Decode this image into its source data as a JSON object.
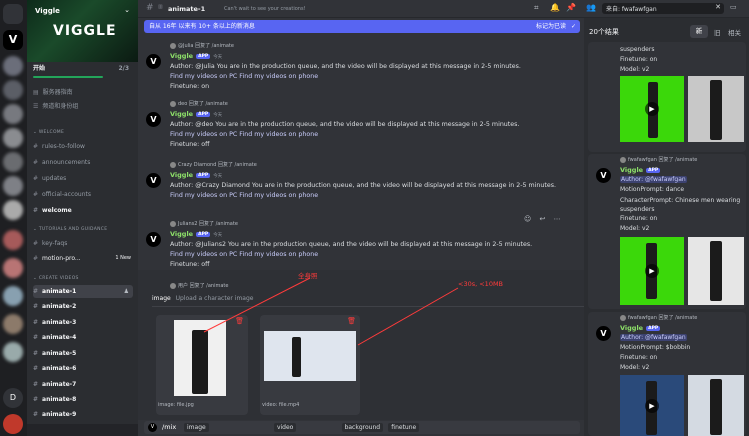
{
  "server": {
    "name": "Viggle",
    "logo": "VIGGLE"
  },
  "channels": {
    "start_label": "开始",
    "start_count": "2/3",
    "items": [
      {
        "label": "服务器指南"
      },
      {
        "label": "频道和身份组"
      }
    ],
    "welcome_category": "WELCOME",
    "welcome_items": [
      {
        "label": "rules-to-follow"
      },
      {
        "label": "announcements"
      },
      {
        "label": "updates"
      },
      {
        "label": "official-accounts"
      },
      {
        "label": "welcome"
      }
    ],
    "tutorials_category": "TUTORIALS AND GUIDANCE",
    "tutorial_items": [
      {
        "label": "key-faqs"
      },
      {
        "label": "motion-pro..."
      }
    ],
    "new_label": "1 New",
    "create_category": "CREATE VIDEOS",
    "create_items": [
      {
        "label": "animate-1"
      },
      {
        "label": "animate-2"
      },
      {
        "label": "animate-3"
      },
      {
        "label": "animate-4"
      },
      {
        "label": "animate-5"
      },
      {
        "label": "animate-6"
      },
      {
        "label": "animate-7"
      },
      {
        "label": "animate-8"
      },
      {
        "label": "animate-9"
      }
    ]
  },
  "topbar": {
    "channel": "animate-1",
    "topic": "Can't wait to see your creations!",
    "search": "来自: fwafawfgan"
  },
  "notice": {
    "text": "自从 16年 以来有 10+ 条以上的新消息",
    "action": "标记为已读"
  },
  "messages": [
    {
      "reply": "@Julia 回复了 /animate",
      "user": "Viggle",
      "app": "APP",
      "time": "今天",
      "body": "Author: @Julia You are in the production queue, and the video will be displayed at this message in 2-5 minutes.",
      "links": "Find my videos on PC   Find my videos on phone",
      "extra": "Finetune: on"
    },
    {
      "reply": "deo 回复了 /animate",
      "user": "Viggle",
      "app": "APP",
      "time": "今天",
      "body": "Author: @deo You are in the production queue, and the video will be displayed at this message in 2-5 minutes.",
      "links": "Find my videos on PC   Find my videos on phone",
      "extra": "Finetune: off"
    },
    {
      "reply": "Crazy Diamond 回复了 /animate",
      "user": "Viggle",
      "app": "APP",
      "time": "今天",
      "body": "Author: @Crazy Diamond You are in the production queue, and the video will be displayed at this message in 2-5 minutes.",
      "links": "Find my videos on PC   Find my videos on phone",
      "extra": ""
    },
    {
      "reply": "Julians2 回复了 /animate",
      "user": "Viggle",
      "app": "APP",
      "time": "今天",
      "body": "Author: @Julians2 You are in the production queue, and the video will be displayed at this message in 2-5 minutes.",
      "links": "Find my videos on PC   Find my videos on phone",
      "extra": "Finetune: off"
    }
  ],
  "upload": {
    "reply": "用户 回复了 /animate",
    "image_label": "image",
    "image_hint": "Upload a character image",
    "annot_left": "全身照",
    "annot_right": "<30s, <10MB",
    "image_caption": "image: file.jpg",
    "video_caption": "video: file.mp4"
  },
  "command": {
    "cmd": "/mix",
    "opts": [
      "image",
      "video",
      "background",
      "finetune"
    ]
  },
  "sidebar": {
    "results": "20个结果",
    "tabs": [
      "新",
      "旧",
      "相关"
    ],
    "top_text": "suspenders",
    "top_finetune": "Finetune: on",
    "top_model": "Model: v2",
    "r2_reply": "fwafawfgan 回复了 /animate",
    "r2_user": "Viggle",
    "r2_author": "Author: @fwafawfgan",
    "r2_motion": "MotionPrompt: dance",
    "r2_char": "CharacterPrompt: Chinese men wearing suspenders",
    "r2_finetune": "Finetune: on",
    "r2_model": "Model: v2",
    "r3_reply": "fwafawfgan 回复了 /animate",
    "r3_user": "Viggle",
    "r3_author": "Author: @fwafawfgan",
    "r3_motion": "MotionPrompt: $bobbin",
    "r3_finetune": "Finetune: on",
    "r3_model": "Model: v2"
  }
}
